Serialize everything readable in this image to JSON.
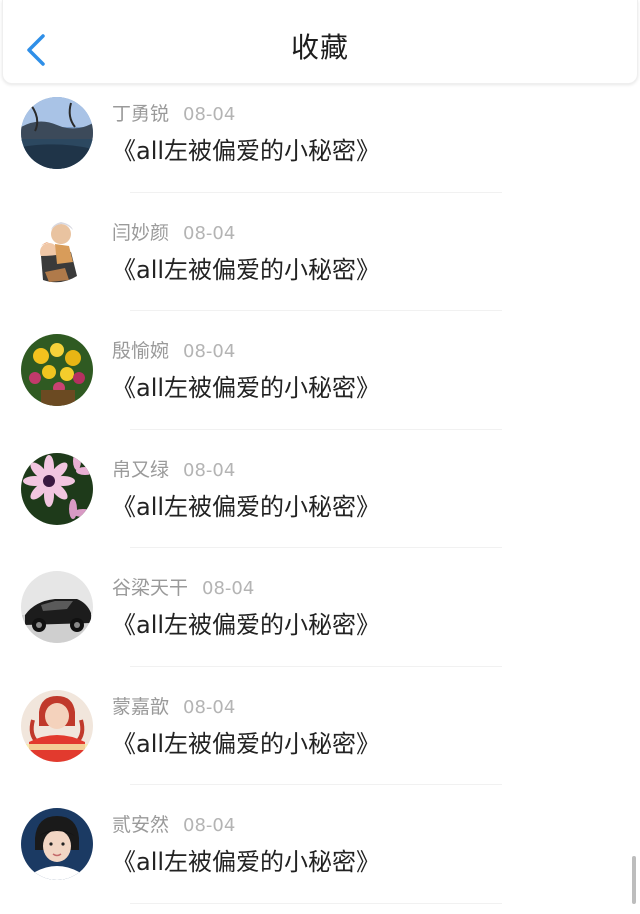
{
  "header": {
    "title": "收藏",
    "back_icon": "chevron-left-icon",
    "accent": "#2f8fe8"
  },
  "items": [
    {
      "name": "丁勇锐",
      "date": "08-04",
      "title": "《all左被偏爱的小秘密》",
      "avatar": "landscape-water"
    },
    {
      "name": "闫妙颜",
      "date": "08-04",
      "title": "《all左被偏爱的小秘密》",
      "avatar": "anime-couple"
    },
    {
      "name": "殷愉婉",
      "date": "08-04",
      "title": "《all左被偏爱的小秘密》",
      "avatar": "yellow-flowers"
    },
    {
      "name": "帛又绿",
      "date": "08-04",
      "title": "《all左被偏爱的小秘密》",
      "avatar": "pink-daisy"
    },
    {
      "name": "谷梁天干",
      "date": "08-04",
      "title": "《all左被偏爱的小秘密》",
      "avatar": "black-car"
    },
    {
      "name": "蒙嘉歆",
      "date": "08-04",
      "title": "《all左被偏爱的小秘密》",
      "avatar": "girl-red-shirt"
    },
    {
      "name": "贰安然",
      "date": "08-04",
      "title": "《all左被偏爱的小秘密》",
      "avatar": "child-portrait"
    }
  ],
  "colors": {
    "name_text": "#9a9a9a",
    "date_text": "#b4b4b4",
    "title_text": "#222222"
  }
}
